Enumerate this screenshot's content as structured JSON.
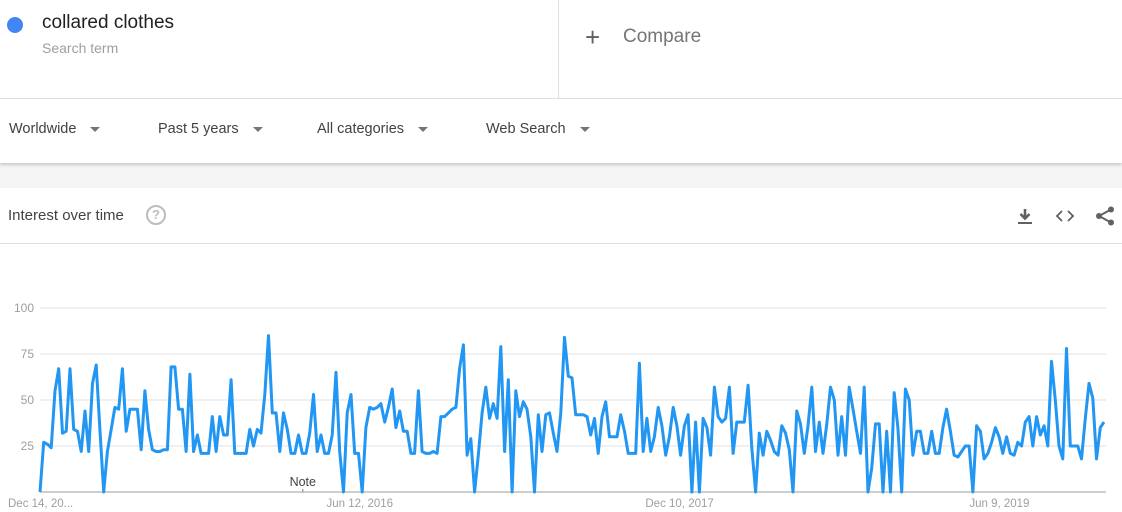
{
  "search": {
    "term": "collared clothes",
    "term_sublabel": "Search term",
    "term_color": "#4285f4",
    "compare_label": "Compare"
  },
  "filters": [
    {
      "label": "Worldwide"
    },
    {
      "label": "Past 5 years"
    },
    {
      "label": "All categories"
    },
    {
      "label": "Web Search"
    }
  ],
  "card": {
    "title": "Interest over time",
    "help_glyph": "?",
    "actions": [
      "download-icon",
      "embed-icon",
      "share-icon"
    ]
  },
  "chart_data": {
    "type": "line",
    "title": "Interest over time",
    "series": [
      {
        "name": "collared clothes",
        "color": "#2196f3",
        "values": [
          0,
          27,
          26,
          24,
          55,
          67,
          32,
          33,
          67,
          34,
          33,
          22,
          44,
          22,
          59,
          69,
          34,
          0,
          22,
          34,
          46,
          45,
          67,
          33,
          45,
          45,
          45,
          23,
          55,
          34,
          23,
          22,
          22,
          23,
          23,
          68,
          68,
          45,
          45,
          22,
          64,
          22,
          31,
          21,
          21,
          21,
          41,
          22,
          41,
          31,
          31,
          61,
          21,
          21,
          21,
          21,
          34,
          25,
          34,
          32,
          53,
          85,
          43,
          43,
          22,
          43,
          34,
          21,
          21,
          31,
          21,
          21,
          32,
          53,
          22,
          31,
          21,
          21,
          31,
          65,
          22,
          0,
          43,
          53,
          21,
          21,
          0,
          35,
          46,
          45,
          46,
          48,
          38,
          46,
          56,
          35,
          44,
          33,
          33,
          21,
          21,
          55,
          22,
          21,
          21,
          22,
          21,
          41,
          41,
          43,
          45,
          46,
          67,
          80,
          20,
          29,
          0,
          20,
          43,
          57,
          40,
          48,
          40,
          79,
          22,
          61,
          0,
          55,
          41,
          49,
          45,
          30,
          0,
          42,
          22,
          42,
          43,
          32,
          22,
          43,
          84,
          63,
          62,
          42,
          42,
          42,
          41,
          31,
          40,
          21,
          41,
          49,
          30,
          30,
          30,
          42,
          33,
          21,
          21,
          21,
          70,
          22,
          40,
          22,
          30,
          46,
          36,
          20,
          30,
          46,
          36,
          20,
          36,
          42,
          0,
          38,
          0,
          40,
          35,
          20,
          57,
          41,
          38,
          40,
          57,
          21,
          38,
          38,
          38,
          58,
          24,
          0,
          32,
          20,
          33,
          28,
          22,
          20,
          36,
          32,
          23,
          0,
          44,
          37,
          21,
          36,
          57,
          22,
          38,
          21,
          37,
          57,
          50,
          20,
          41,
          20,
          57,
          45,
          33,
          21,
          57,
          0,
          13,
          37,
          37,
          0,
          33,
          0,
          54,
          35,
          0,
          56,
          50,
          20,
          33,
          33,
          21,
          21,
          33,
          21,
          21,
          35,
          45,
          33,
          20,
          19,
          22,
          25,
          25,
          0,
          36,
          33,
          18,
          21,
          27,
          35,
          30,
          21,
          30,
          21,
          20,
          27,
          25,
          38,
          41,
          25,
          41,
          31,
          36,
          25,
          71,
          50,
          25,
          18,
          78,
          25,
          25,
          25,
          18,
          40,
          59,
          51,
          18,
          35,
          38
        ]
      }
    ],
    "ylim": [
      0,
      100
    ],
    "yticks": [
      "100",
      "75",
      "50",
      "25"
    ],
    "ytick_values": [
      100,
      75,
      50,
      25
    ],
    "xticks": [
      {
        "label": "Dec 14, 20...",
        "fraction": 0.0
      },
      {
        "label": "Jun 12, 2016",
        "fraction": 0.3
      },
      {
        "label": "Dec 10, 2017",
        "fraction": 0.6
      },
      {
        "label": "Jun 9, 2019",
        "fraction": 0.9
      }
    ],
    "annotations": [
      {
        "label": "Note",
        "fraction": 0.209
      }
    ],
    "grid": true,
    "legend": "none"
  }
}
